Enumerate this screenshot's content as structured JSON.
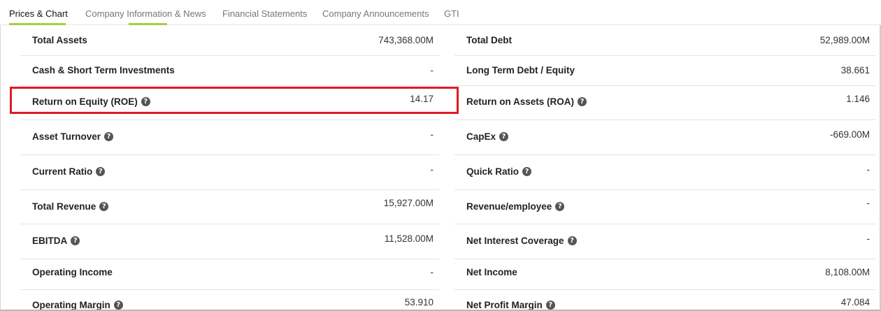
{
  "tabs": [
    {
      "label": "Prices & Chart",
      "active": true
    },
    {
      "label": "Company Information & News",
      "active": false
    },
    {
      "label": "Financial Statements",
      "active": false
    },
    {
      "label": "Company Announcements",
      "active": false
    },
    {
      "label": "GTI",
      "active": false
    }
  ],
  "left": [
    {
      "label": "Total Assets",
      "value": "743,368.00M",
      "help": false
    },
    {
      "label": "Cash & Short Term Investments",
      "value": "-",
      "help": false
    },
    {
      "label": "Return on Equity (ROE)",
      "value": "14.17",
      "help": true
    },
    {
      "label": "Asset Turnover",
      "value": "-",
      "help": true
    },
    {
      "label": "Current Ratio",
      "value": "-",
      "help": true
    },
    {
      "label": "Total Revenue",
      "value": "15,927.00M",
      "help": true
    },
    {
      "label": "EBITDA",
      "value": "11,528.00M",
      "help": true
    },
    {
      "label": "Operating Income",
      "value": "-",
      "help": false
    },
    {
      "label": "Operating Margin",
      "value": "53.910",
      "help": true
    }
  ],
  "right": [
    {
      "label": "Total Debt",
      "value": "52,989.00M",
      "help": false
    },
    {
      "label": "Long Term Debt / Equity",
      "value": "38.661",
      "help": false
    },
    {
      "label": "Return on Assets (ROA)",
      "value": "1.146",
      "help": true
    },
    {
      "label": "CapEx",
      "value": "-669.00M",
      "help": true
    },
    {
      "label": "Quick Ratio",
      "value": "-",
      "help": true
    },
    {
      "label": "Revenue/employee",
      "value": "-",
      "help": true
    },
    {
      "label": "Net Interest Coverage",
      "value": "-",
      "help": true
    },
    {
      "label": "Net Income",
      "value": "8,108.00M",
      "help": false
    },
    {
      "label": "Net Profit Margin",
      "value": "47.084",
      "help": true
    }
  ],
  "highlight_color": "#e01b24",
  "accent_color": "#a6cf3a"
}
